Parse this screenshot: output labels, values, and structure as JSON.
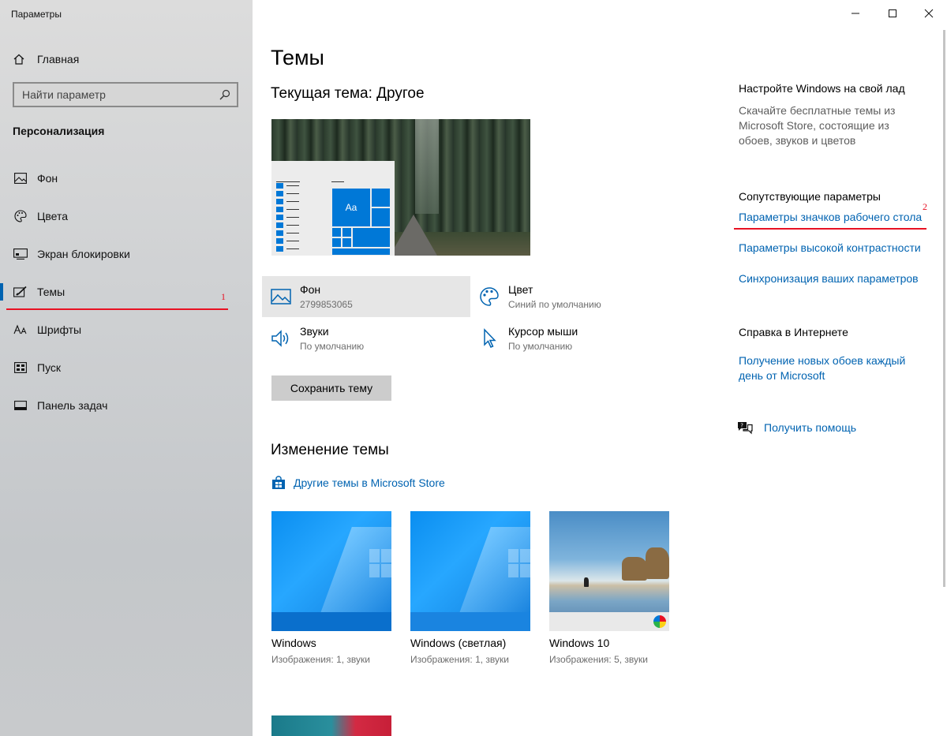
{
  "window": {
    "title": "Параметры",
    "controls": {
      "minimize": "—",
      "maximize": "☐",
      "close": "✕"
    }
  },
  "sidebar": {
    "home_label": "Главная",
    "search_placeholder": "Найти параметр",
    "section_title": "Персонализация",
    "items": [
      {
        "label": "Фон",
        "icon": "picture-icon"
      },
      {
        "label": "Цвета",
        "icon": "palette-icon"
      },
      {
        "label": "Экран блокировки",
        "icon": "lock-screen-icon"
      },
      {
        "label": "Темы",
        "icon": "brush-icon",
        "active": true
      },
      {
        "label": "Шрифты",
        "icon": "font-icon"
      },
      {
        "label": "Пуск",
        "icon": "start-icon"
      },
      {
        "label": "Панель задач",
        "icon": "taskbar-icon"
      }
    ]
  },
  "annotations": {
    "marker1": "1",
    "marker2": "2",
    "color": "#e81123"
  },
  "main": {
    "title": "Темы",
    "current_theme": "Текущая тема: Другое",
    "preview_tile_text": "Aa",
    "options": [
      {
        "title": "Фон",
        "value": "2799853065",
        "icon": "picture-icon",
        "selected": true
      },
      {
        "title": "Цвет",
        "value": "Синий по умолчанию",
        "icon": "palette-icon"
      },
      {
        "title": "Звуки",
        "value": "По умолчанию",
        "icon": "speaker-icon"
      },
      {
        "title": "Курсор мыши",
        "value": "По умолчанию",
        "icon": "cursor-icon"
      }
    ],
    "save_button": "Сохранить тему",
    "change_theme_title": "Изменение темы",
    "store_link": "Другие темы в Microsoft Store",
    "themes": [
      {
        "name": "Windows",
        "desc": "Изображения: 1, звуки"
      },
      {
        "name": "Windows (светлая)",
        "desc": "Изображения: 1, звуки"
      },
      {
        "name": "Windows 10",
        "desc": "Изображения: 5, звуки"
      }
    ]
  },
  "right": {
    "customize_title": "Настройте Windows на свой лад",
    "customize_desc": "Скачайте бесплатные темы из Microsoft Store, состоящие из обоев, звуков и цветов",
    "related_title": "Сопутствующие параметры",
    "related_links": [
      "Параметры значков рабочего стола",
      "Параметры высокой контрастности",
      "Синхронизация ваших параметров"
    ],
    "online_help_title": "Справка в Интернете",
    "online_help_link": "Получение новых обоев каждый день от Microsoft",
    "get_help": "Получить помощь"
  },
  "colors": {
    "accent": "#0078d7",
    "link": "#0063b1",
    "sidebar_bg": "#cfd1d3"
  }
}
